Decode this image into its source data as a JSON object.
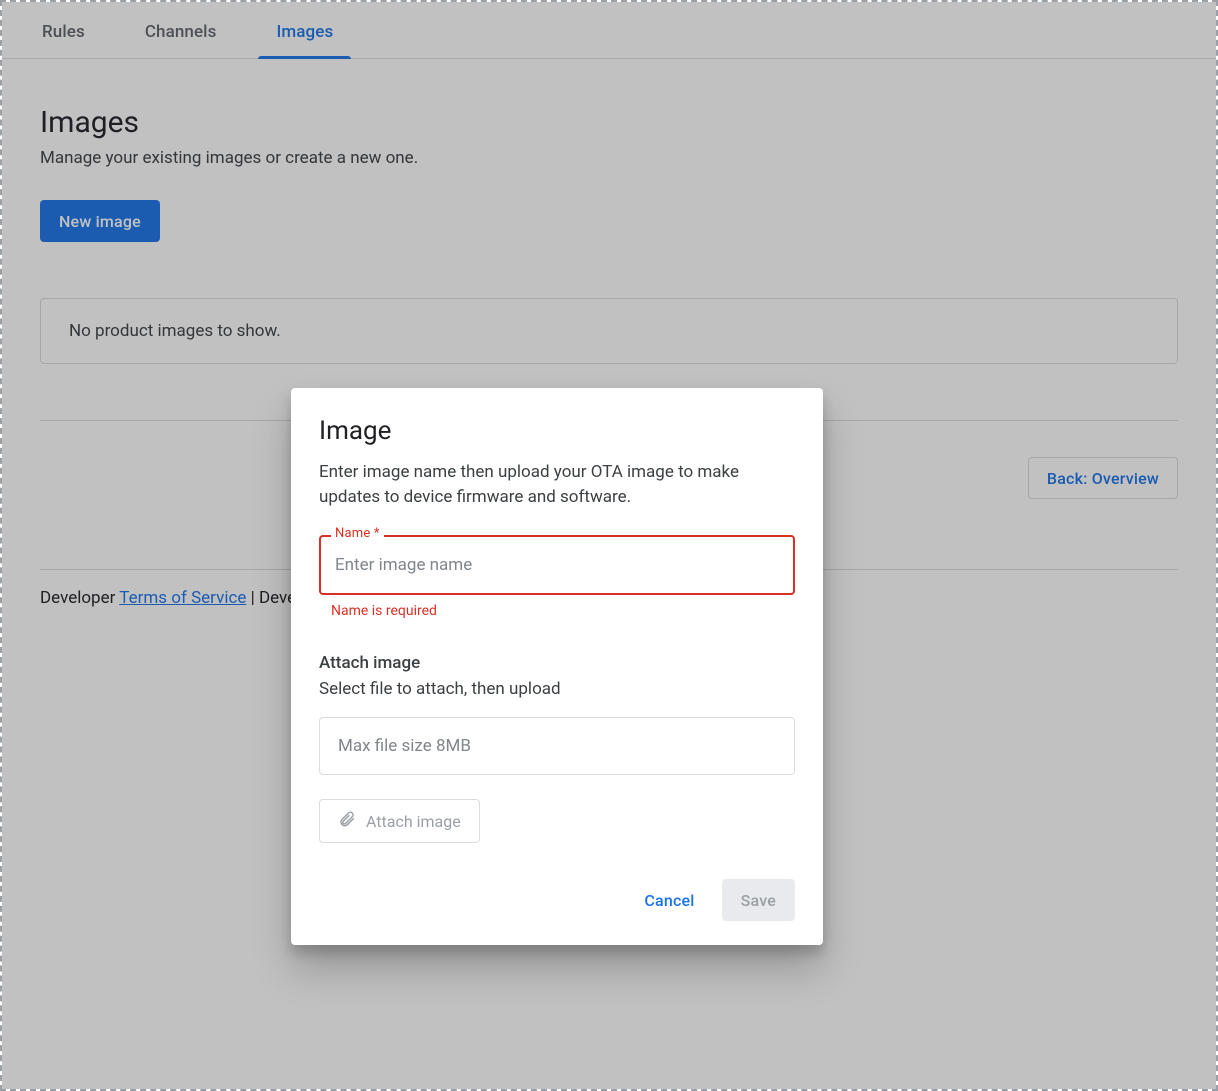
{
  "tabs": {
    "rules": "Rules",
    "channels": "Channels",
    "images": "Images"
  },
  "header": {
    "title": "Images",
    "description": "Manage your existing images or create a new one."
  },
  "buttons": {
    "new_image": "New image",
    "back": "Back: Overview"
  },
  "empty_state": "No product images to show.",
  "footer": {
    "prefix": "Developer ",
    "tos": "Terms of Service",
    "suffix": " | Deve"
  },
  "dialog": {
    "title": "Image",
    "description": "Enter image name then upload your OTA image to make updates to device firmware and software.",
    "name_label": "Name *",
    "name_placeholder": "Enter image name",
    "name_value": "",
    "name_error": "Name is required",
    "attach_heading": "Attach image",
    "attach_sub": "Select file to attach, then upload",
    "file_placeholder": "Max file size 8MB",
    "attach_button": "Attach image",
    "cancel": "Cancel",
    "save": "Save"
  }
}
